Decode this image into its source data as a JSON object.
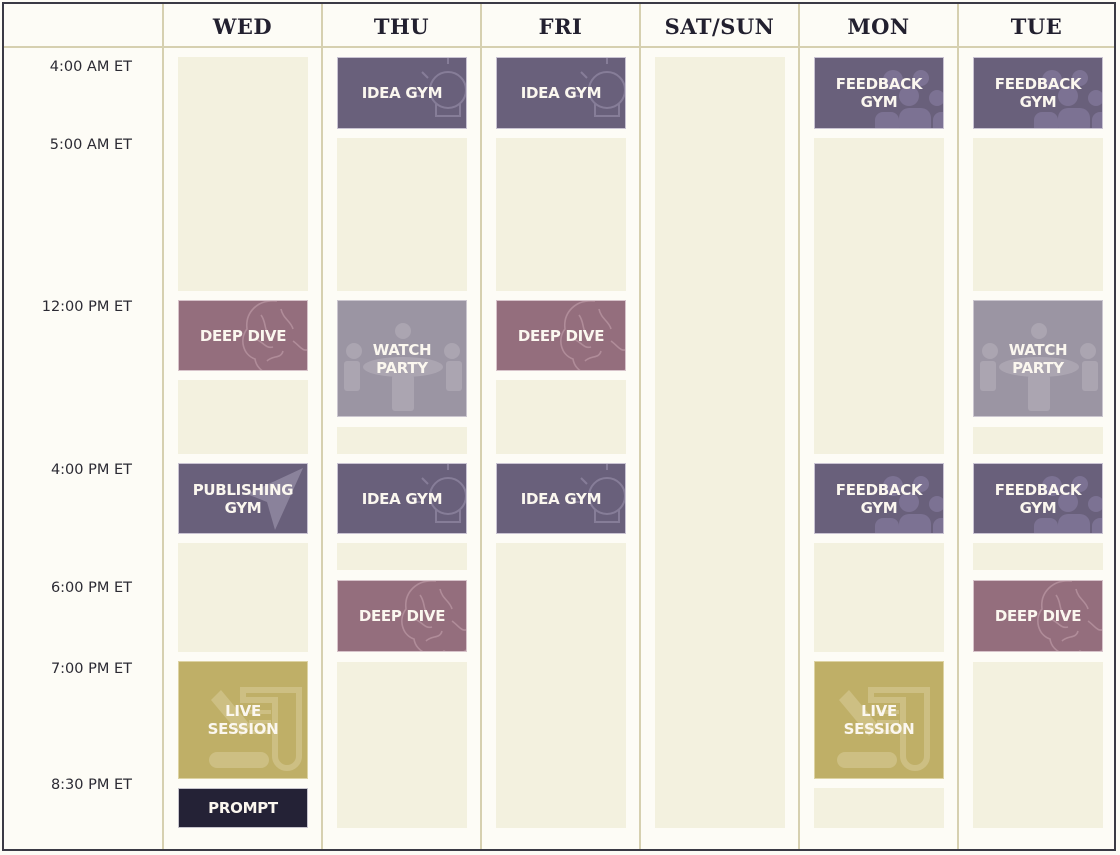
{
  "schedule": {
    "days": [
      "WED",
      "THU",
      "FRI",
      "SAT/SUN",
      "MON",
      "TUE"
    ],
    "times": [
      "4:00 AM ET",
      "5:00 AM ET",
      "12:00 PM ET",
      "4:00 PM ET",
      "6:00 PM ET",
      "7:00 PM ET",
      "8:30 PM ET"
    ],
    "event_labels": {
      "idea_gym": "IDEA GYM",
      "feedback_gym_1": "FEEDBACK",
      "feedback_gym_2": "GYM",
      "deep_dive": "DEEP DIVE",
      "watch_party_1": "WATCH",
      "watch_party_2": "PARTY",
      "publishing_gym_1": "PUBLISHING",
      "publishing_gym_2": "GYM",
      "live_session_1": "LIVE",
      "live_session_2": "SESSION",
      "prompt": "PROMPT"
    },
    "colors": {
      "gym": "#69607b",
      "deep_dive": "#946e7d",
      "watch_party": "#9b95a3",
      "live_session": "#bfaf67",
      "prompt": "#242236",
      "empty_slot": "#f3f1df",
      "grid_line": "#d6d0b0"
    },
    "events": [
      {
        "day": "THU",
        "time": "4:00 AM ET",
        "type": "IDEA GYM"
      },
      {
        "day": "FRI",
        "time": "4:00 AM ET",
        "type": "IDEA GYM"
      },
      {
        "day": "MON",
        "time": "4:00 AM ET",
        "type": "FEEDBACK GYM"
      },
      {
        "day": "TUE",
        "time": "4:00 AM ET",
        "type": "FEEDBACK GYM"
      },
      {
        "day": "WED",
        "time": "12:00 PM ET",
        "type": "DEEP DIVE"
      },
      {
        "day": "THU",
        "time": "12:00 PM ET",
        "type": "WATCH PARTY"
      },
      {
        "day": "FRI",
        "time": "12:00 PM ET",
        "type": "DEEP DIVE"
      },
      {
        "day": "TUE",
        "time": "12:00 PM ET",
        "type": "WATCH PARTY"
      },
      {
        "day": "WED",
        "time": "4:00 PM ET",
        "type": "PUBLISHING GYM"
      },
      {
        "day": "THU",
        "time": "4:00 PM ET",
        "type": "IDEA GYM"
      },
      {
        "day": "FRI",
        "time": "4:00 PM ET",
        "type": "IDEA GYM"
      },
      {
        "day": "MON",
        "time": "4:00 PM ET",
        "type": "FEEDBACK GYM"
      },
      {
        "day": "TUE",
        "time": "4:00 PM ET",
        "type": "FEEDBACK GYM"
      },
      {
        "day": "THU",
        "time": "6:00 PM ET",
        "type": "DEEP DIVE"
      },
      {
        "day": "TUE",
        "time": "6:00 PM ET",
        "type": "DEEP DIVE"
      },
      {
        "day": "WED",
        "time": "7:00 PM ET",
        "type": "LIVE SESSION"
      },
      {
        "day": "MON",
        "time": "7:00 PM ET",
        "type": "LIVE SESSION"
      },
      {
        "day": "WED",
        "time": "8:30 PM ET",
        "type": "PROMPT"
      }
    ]
  }
}
